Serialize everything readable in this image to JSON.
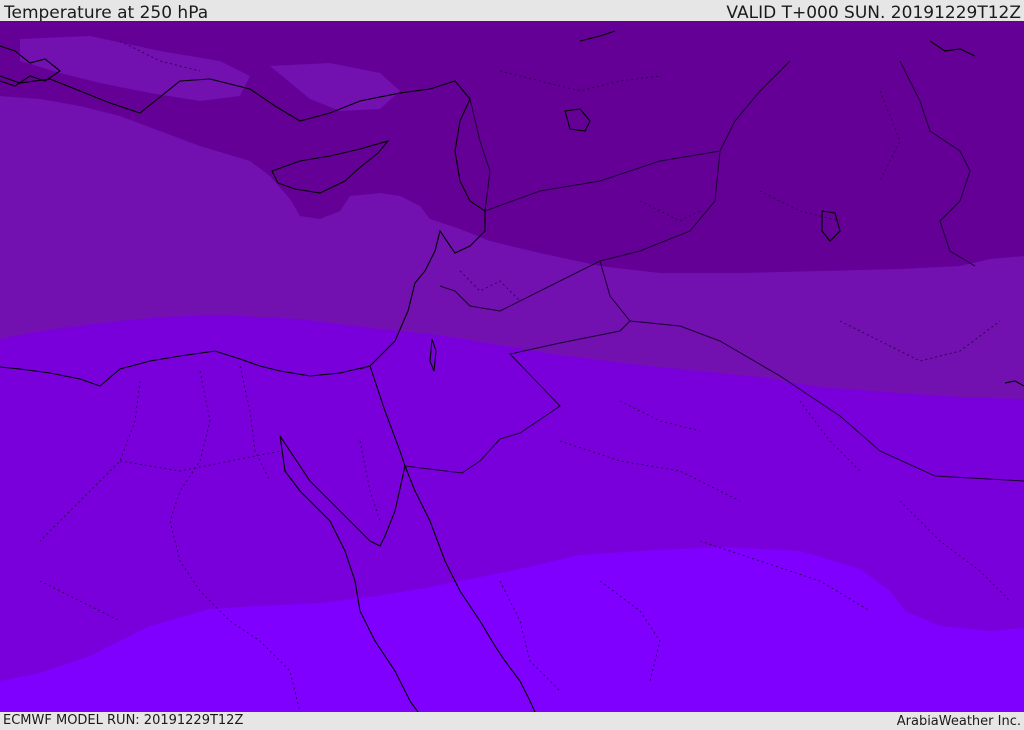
{
  "header": {
    "title": "Temperature at 250 hPa",
    "valid": "VALID T+000 SUN. 20191229T12Z"
  },
  "footer": {
    "model_run": "ECMWF MODEL RUN: 20191229T12Z",
    "credit": "ArabiaWeather Inc."
  },
  "map": {
    "band_colors": {
      "coldest": "#650096",
      "cold": "#7210b0",
      "mid": "#7a00db",
      "warm": "#7f00ff"
    },
    "coast_color": "#000000",
    "border_color": "#1a0030"
  }
}
